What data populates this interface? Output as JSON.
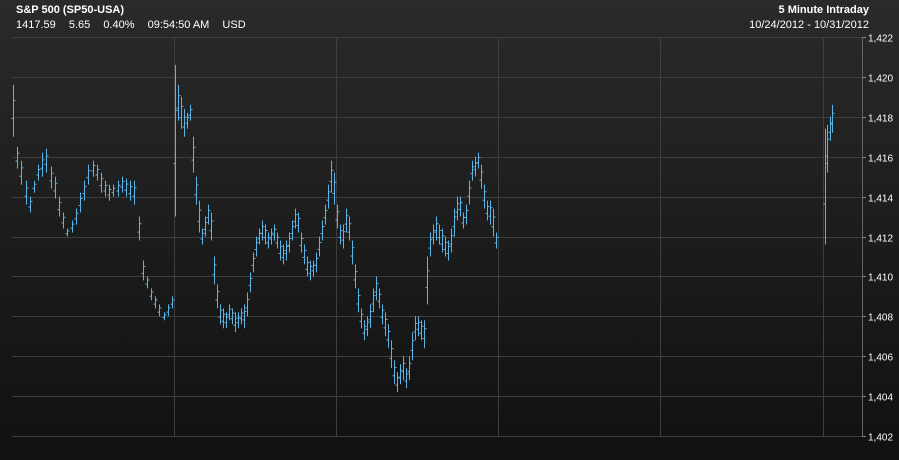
{
  "header": {
    "title": "S&P 500 (SP50-USA)",
    "last": "1417.59",
    "change": "5.65",
    "change_pct": "0.40%",
    "time": "09:54:50 AM",
    "currency": "USD",
    "chart_label": "5 Minute Intraday",
    "date_range": "10/24/2012 - 10/31/2012"
  },
  "colors": {
    "bar": "#5ab4e8",
    "grid": "#3e3e3e",
    "axis_text": "#ffffff"
  },
  "chart_data": {
    "type": "bar",
    "subtype": "ohlc",
    "ylim": [
      1402,
      1422
    ],
    "yticks": [
      1402,
      1404,
      1406,
      1408,
      1410,
      1412,
      1414,
      1416,
      1418,
      1420,
      1422
    ],
    "ytick_labels": [
      "1,402",
      "1,404",
      "1,406",
      "1,408",
      "1,410",
      "1,412",
      "1,414",
      "1,416",
      "1,418",
      "1,420",
      "1,422"
    ],
    "grid": true,
    "axis_position": "right",
    "sessions": [
      {
        "id": "day1",
        "points": [
          [
            1419.6,
            1417.0
          ],
          [
            1416.5,
            1415.4
          ],
          [
            1415.8,
            1414.6
          ],
          [
            1414.8,
            1413.6
          ],
          [
            1414.0,
            1413.2
          ],
          [
            1414.8,
            1414.2
          ],
          [
            1415.6,
            1414.8
          ],
          [
            1416.2,
            1415.0
          ],
          [
            1416.4,
            1415.2
          ],
          [
            1415.5,
            1414.4
          ],
          [
            1415.0,
            1413.9
          ],
          [
            1414.0,
            1413.0
          ],
          [
            1413.2,
            1412.4
          ],
          [
            1412.4,
            1412.0
          ],
          [
            1412.8,
            1412.2
          ],
          [
            1413.4,
            1412.6
          ],
          [
            1414.2,
            1413.2
          ],
          [
            1414.8,
            1413.8
          ],
          [
            1415.6,
            1414.6
          ],
          [
            1415.8,
            1415.0
          ],
          [
            1415.6,
            1414.8
          ],
          [
            1415.2,
            1414.2
          ],
          [
            1414.8,
            1414.0
          ],
          [
            1414.6,
            1413.8
          ],
          [
            1414.6,
            1414.0
          ],
          [
            1414.8,
            1414.0
          ],
          [
            1415.0,
            1414.2
          ],
          [
            1414.9,
            1414.0
          ],
          [
            1414.8,
            1413.8
          ],
          [
            1414.8,
            1413.6
          ],
          [
            1413.0,
            1411.8
          ],
          [
            1410.8,
            1409.8
          ],
          [
            1410.0,
            1409.4
          ],
          [
            1409.4,
            1408.8
          ],
          [
            1409.0,
            1408.4
          ],
          [
            1408.6,
            1408.0
          ],
          [
            1408.2,
            1407.8
          ],
          [
            1408.6,
            1408.0
          ],
          [
            1409.0,
            1408.4
          ]
        ]
      },
      {
        "id": "day2",
        "points": [
          [
            1420.6,
            1413.0
          ],
          [
            1419.6,
            1417.8
          ],
          [
            1419.0,
            1417.4
          ],
          [
            1418.4,
            1417.0
          ],
          [
            1418.2,
            1417.4
          ],
          [
            1418.6,
            1417.8
          ],
          [
            1417.0,
            1415.2
          ],
          [
            1415.0,
            1413.6
          ],
          [
            1413.8,
            1412.2
          ],
          [
            1412.4,
            1411.6
          ],
          [
            1413.0,
            1412.0
          ],
          [
            1413.6,
            1412.6
          ],
          [
            1413.2,
            1411.8
          ],
          [
            1411.0,
            1409.6
          ],
          [
            1409.6,
            1408.4
          ],
          [
            1408.6,
            1407.6
          ],
          [
            1408.4,
            1407.4
          ],
          [
            1408.2,
            1407.4
          ],
          [
            1408.6,
            1407.8
          ],
          [
            1408.4,
            1407.6
          ],
          [
            1408.2,
            1407.2
          ],
          [
            1408.2,
            1407.4
          ],
          [
            1408.4,
            1407.6
          ],
          [
            1408.6,
            1407.4
          ],
          [
            1409.2,
            1408.0
          ],
          [
            1410.2,
            1409.2
          ],
          [
            1411.2,
            1410.2
          ],
          [
            1412.0,
            1411.0
          ],
          [
            1412.4,
            1411.6
          ],
          [
            1412.8,
            1411.8
          ],
          [
            1412.6,
            1411.6
          ],
          [
            1412.2,
            1411.4
          ],
          [
            1412.4,
            1411.6
          ],
          [
            1412.6,
            1411.8
          ],
          [
            1412.2,
            1411.4
          ],
          [
            1411.8,
            1410.8
          ],
          [
            1411.6,
            1410.6
          ],
          [
            1411.8,
            1410.8
          ],
          [
            1412.2,
            1411.2
          ],
          [
            1412.8,
            1411.8
          ],
          [
            1413.4,
            1412.4
          ],
          [
            1413.2,
            1412.2
          ],
          [
            1412.2,
            1411.2
          ],
          [
            1411.6,
            1410.6
          ],
          [
            1411.0,
            1410.0
          ],
          [
            1410.8,
            1409.8
          ],
          [
            1410.8,
            1410.0
          ],
          [
            1411.2,
            1410.2
          ],
          [
            1412.0,
            1411.0
          ],
          [
            1412.8,
            1411.8
          ],
          [
            1413.6,
            1412.6
          ],
          [
            1414.6,
            1413.4
          ],
          [
            1415.8,
            1414.2
          ],
          [
            1415.2,
            1413.6
          ],
          [
            1413.6,
            1412.4
          ],
          [
            1412.6,
            1411.6
          ],
          [
            1412.6,
            1411.4
          ],
          [
            1413.4,
            1412.2
          ],
          [
            1413.0,
            1411.8
          ],
          [
            1411.8,
            1410.6
          ],
          [
            1410.6,
            1409.4
          ],
          [
            1409.4,
            1408.2
          ],
          [
            1408.4,
            1407.4
          ],
          [
            1407.8,
            1406.8
          ],
          [
            1408.0,
            1407.0
          ],
          [
            1408.6,
            1407.4
          ],
          [
            1409.4,
            1408.2
          ],
          [
            1410.0,
            1408.8
          ],
          [
            1409.4,
            1408.4
          ],
          [
            1408.6,
            1407.6
          ],
          [
            1408.2,
            1407.0
          ],
          [
            1407.6,
            1406.4
          ],
          [
            1406.8,
            1405.4
          ],
          [
            1405.8,
            1404.6
          ],
          [
            1405.2,
            1404.2
          ],
          [
            1405.6,
            1404.6
          ],
          [
            1406.0,
            1404.8
          ],
          [
            1405.4,
            1404.4
          ],
          [
            1406.0,
            1404.8
          ],
          [
            1407.2,
            1405.8
          ],
          [
            1408.0,
            1406.8
          ],
          [
            1408.0,
            1407.0
          ],
          [
            1407.8,
            1406.8
          ],
          [
            1407.8,
            1406.4
          ],
          [
            1411.0,
            1408.6
          ],
          [
            1412.2,
            1411.0
          ],
          [
            1412.6,
            1411.6
          ],
          [
            1413.0,
            1411.8
          ],
          [
            1412.6,
            1411.6
          ],
          [
            1412.4,
            1411.2
          ],
          [
            1412.0,
            1411.0
          ],
          [
            1411.8,
            1410.8
          ],
          [
            1412.4,
            1411.2
          ],
          [
            1413.4,
            1412.0
          ],
          [
            1414.0,
            1412.8
          ],
          [
            1414.0,
            1413.0
          ],
          [
            1413.2,
            1412.4
          ],
          [
            1413.6,
            1412.6
          ],
          [
            1414.8,
            1413.6
          ],
          [
            1415.8,
            1414.8
          ],
          [
            1416.0,
            1415.0
          ],
          [
            1416.2,
            1415.4
          ],
          [
            1415.6,
            1414.4
          ],
          [
            1414.6,
            1413.4
          ],
          [
            1413.8,
            1412.8
          ],
          [
            1413.8,
            1412.6
          ],
          [
            1413.4,
            1412.0
          ],
          [
            1412.2,
            1411.4
          ]
        ]
      },
      {
        "id": "day3",
        "points": [
          [
            1417.4,
            1411.6
          ],
          [
            1417.6,
            1415.2
          ],
          [
            1418.0,
            1416.8
          ],
          [
            1418.6,
            1417.2
          ]
        ]
      }
    ]
  }
}
